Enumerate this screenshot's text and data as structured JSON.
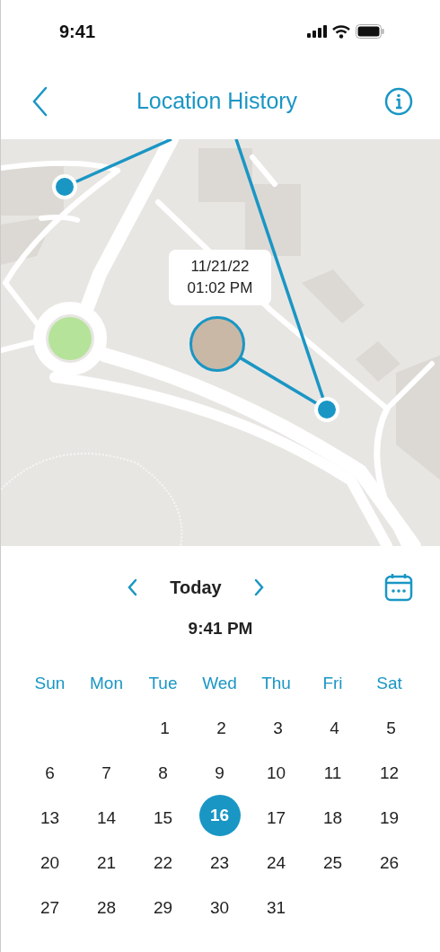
{
  "status_bar": {
    "time": "9:41"
  },
  "header": {
    "title": "Location History"
  },
  "map": {
    "tooltip": {
      "date": "11/21/22",
      "time": "01:02 PM"
    }
  },
  "date_nav": {
    "label": "Today",
    "time": "9:41 PM"
  },
  "calendar": {
    "weekdays": [
      "Sun",
      "Mon",
      "Tue",
      "Wed",
      "Thu",
      "Fri",
      "Sat"
    ],
    "weeks": [
      [
        {
          "label": "1",
          "selected": false
        },
        {
          "label": "2",
          "selected": false
        },
        {
          "label": "3",
          "selected": false
        },
        {
          "label": "4",
          "selected": false
        },
        {
          "label": "5",
          "selected": false
        }
      ],
      [
        {
          "label": "6",
          "selected": false
        },
        {
          "label": "7",
          "selected": false
        },
        {
          "label": "8",
          "selected": false
        },
        {
          "label": "9",
          "selected": false
        },
        {
          "label": "10",
          "selected": false
        },
        {
          "label": "11",
          "selected": false
        },
        {
          "label": "12",
          "selected": false
        }
      ],
      [
        {
          "label": "13",
          "selected": false
        },
        {
          "label": "14",
          "selected": false
        },
        {
          "label": "15",
          "selected": false
        },
        {
          "label": "16",
          "selected": true
        },
        {
          "label": "17",
          "selected": false
        },
        {
          "label": "18",
          "selected": false
        },
        {
          "label": "19",
          "selected": false
        }
      ],
      [
        {
          "label": "20",
          "selected": false
        },
        {
          "label": "21",
          "selected": false
        },
        {
          "label": "22",
          "selected": false
        },
        {
          "label": "23",
          "selected": false
        },
        {
          "label": "24",
          "selected": false
        },
        {
          "label": "25",
          "selected": false
        },
        {
          "label": "26",
          "selected": false
        }
      ],
      [
        {
          "label": "27",
          "selected": false
        },
        {
          "label": "28",
          "selected": false
        },
        {
          "label": "29",
          "selected": false
        },
        {
          "label": "30",
          "selected": false
        },
        {
          "label": "31",
          "selected": false
        }
      ]
    ]
  }
}
